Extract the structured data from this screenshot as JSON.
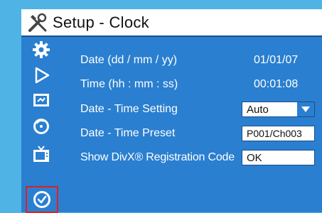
{
  "window": {
    "title": "Setup - Clock"
  },
  "sidebar": {
    "items": [
      {
        "icon": "gear-icon"
      },
      {
        "icon": "play-icon"
      },
      {
        "icon": "screen-settings-icon"
      },
      {
        "icon": "disc-icon"
      },
      {
        "icon": "tv-icon"
      },
      {
        "icon": "clock-icon",
        "selected": true
      }
    ]
  },
  "settings": {
    "date_label": "Date (dd / mm / yy)",
    "date_value": "01/01/07",
    "time_label": "Time (hh : mm : ss)",
    "time_value": "00:01:08",
    "date_time_setting_label": "Date - Time Setting",
    "date_time_setting_value": "Auto",
    "date_time_preset_label": "Date - Time Preset",
    "date_time_preset_value": "P001/Ch003",
    "divx_label": "Show DivX® Registration Code",
    "divx_value": "OK"
  },
  "colors": {
    "panel": "#2a7fd0",
    "background": "#4fb3e6",
    "selection": "#e02020"
  }
}
